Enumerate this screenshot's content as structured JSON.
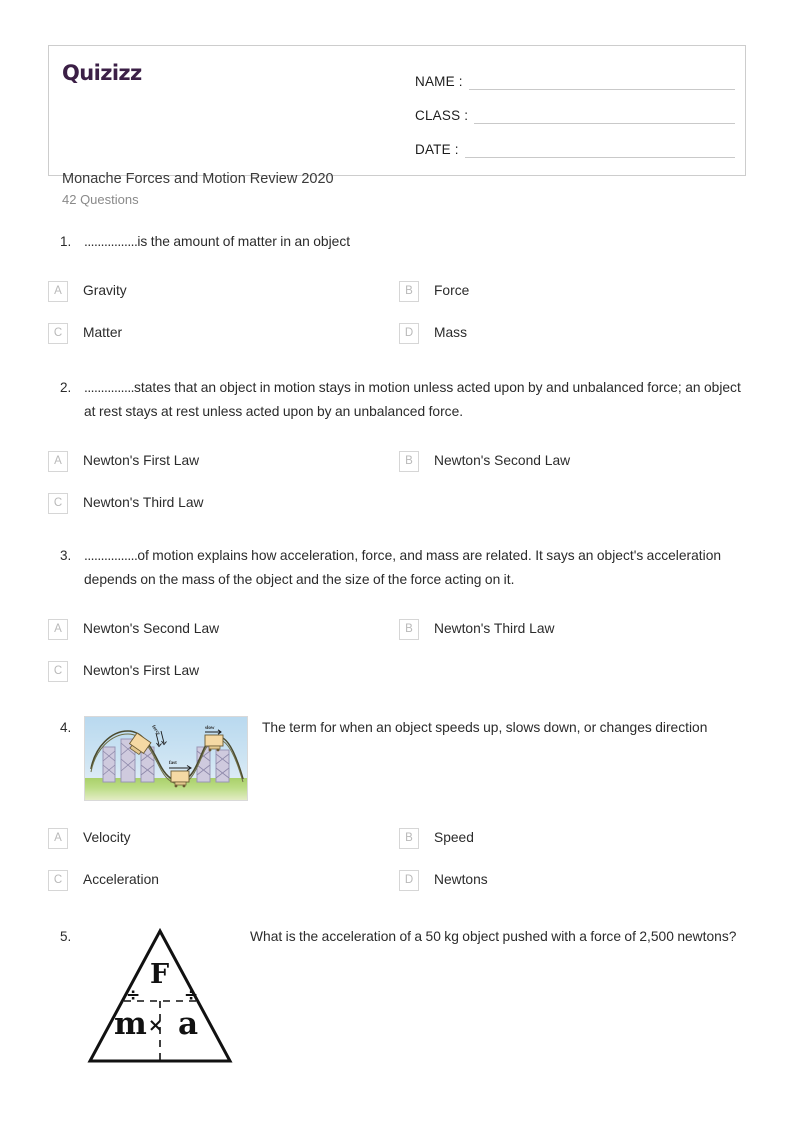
{
  "header": {
    "brand": "Quizizz",
    "brand_color": "#3b1f46",
    "title": "Monache Forces and Motion Review 2020",
    "question_count": "42 Questions",
    "fields": [
      {
        "label": "NAME :",
        "value": ""
      },
      {
        "label": "CLASS :",
        "value": ""
      },
      {
        "label": "DATE  :",
        "value": ""
      }
    ]
  },
  "questions": [
    {
      "number": "1.",
      "leader": "................",
      "text": "is the amount of matter in an object",
      "options": [
        {
          "letter": "A",
          "label": "Gravity"
        },
        {
          "letter": "B",
          "label": "Force"
        },
        {
          "letter": "C",
          "label": "Matter"
        },
        {
          "letter": "D",
          "label": "Mass"
        }
      ]
    },
    {
      "number": "2.",
      "leader": "...............",
      "text": "states that an object in motion stays in motion unless acted upon by and unbalanced force; an object at rest stays at rest unless acted upon by an unbalanced force.",
      "options": [
        {
          "letter": "A",
          "label": "Newton's First Law"
        },
        {
          "letter": "B",
          "label": "Newton's Second Law"
        },
        {
          "letter": "C",
          "label": "Newton's Third Law"
        }
      ]
    },
    {
      "number": "3.",
      "leader": "................",
      "text": "of motion explains how acceleration, force, and mass are related. It says an object's acceleration depends on the mass of the object and the size of the force acting on it.",
      "options": [
        {
          "letter": "A",
          "label": "Newton's Second Law"
        },
        {
          "letter": "B",
          "label": "Newton's Third Law"
        },
        {
          "letter": "C",
          "label": "Newton's First Law"
        }
      ]
    },
    {
      "number": "4.",
      "leader": "",
      "text": "The term for when an object speeds up, slows down, or changes direction",
      "image": {
        "name": "roller-coaster-illustration",
        "labels": {
          "fast": "fast",
          "slow": "slow",
          "force": "force"
        }
      },
      "options": [
        {
          "letter": "A",
          "label": "Velocity"
        },
        {
          "letter": "B",
          "label": "Speed"
        },
        {
          "letter": "C",
          "label": "Acceleration"
        },
        {
          "letter": "D",
          "label": "Newtons"
        }
      ]
    },
    {
      "number": "5.",
      "leader": "",
      "text": "What is the acceleration of a 50 kg object pushed with a force of 2,500 newtons?",
      "image": {
        "name": "force-mass-acceleration-triangle",
        "glyphs": {
          "force": "F",
          "mass": "m",
          "accel": "a",
          "times": "×",
          "div": "÷"
        }
      },
      "options": []
    }
  ]
}
